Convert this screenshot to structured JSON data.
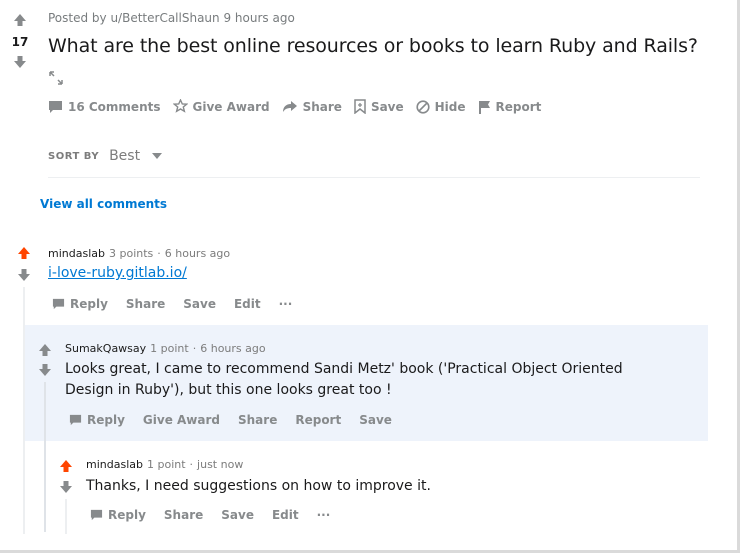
{
  "post": {
    "posted_by": "Posted by u/BetterCallShaun",
    "time": "9 hours ago",
    "score": "17",
    "title": "What are the best online resources or books to learn Ruby and Rails?",
    "actions": {
      "comments": "16 Comments",
      "give_award": "Give Award",
      "share": "Share",
      "save": "Save",
      "hide": "Hide",
      "report": "Report"
    }
  },
  "sort": {
    "label": "SORT BY",
    "value": "Best"
  },
  "view_all": "View all comments",
  "colors": {
    "upvote": "#ff4500",
    "link": "#0079d3",
    "highlight": "#eef3fb"
  },
  "comments": [
    {
      "user": "mindaslab",
      "points": "3 points",
      "dot": "·",
      "time": "6 hours ago",
      "link_text": "i-love-ruby.gitlab.io/",
      "actions": {
        "reply": "Reply",
        "share": "Share",
        "save": "Save",
        "edit": "Edit",
        "more": "···"
      }
    },
    {
      "user": "SumakQawsay",
      "points": "1 point",
      "dot": "·",
      "time": "6 hours ago",
      "body": "Looks great, I came to recommend Sandi Metz' book ('Practical Object Oriented Design in Ruby'), but this one looks great too !",
      "actions": {
        "reply": "Reply",
        "give_award": "Give Award",
        "share": "Share",
        "report": "Report",
        "save": "Save"
      }
    },
    {
      "user": "mindaslab",
      "points": "1 point",
      "dot": "·",
      "time": "just now",
      "body": "Thanks, I need suggestions on how to improve it.",
      "actions": {
        "reply": "Reply",
        "share": "Share",
        "save": "Save",
        "edit": "Edit",
        "more": "···"
      }
    }
  ]
}
